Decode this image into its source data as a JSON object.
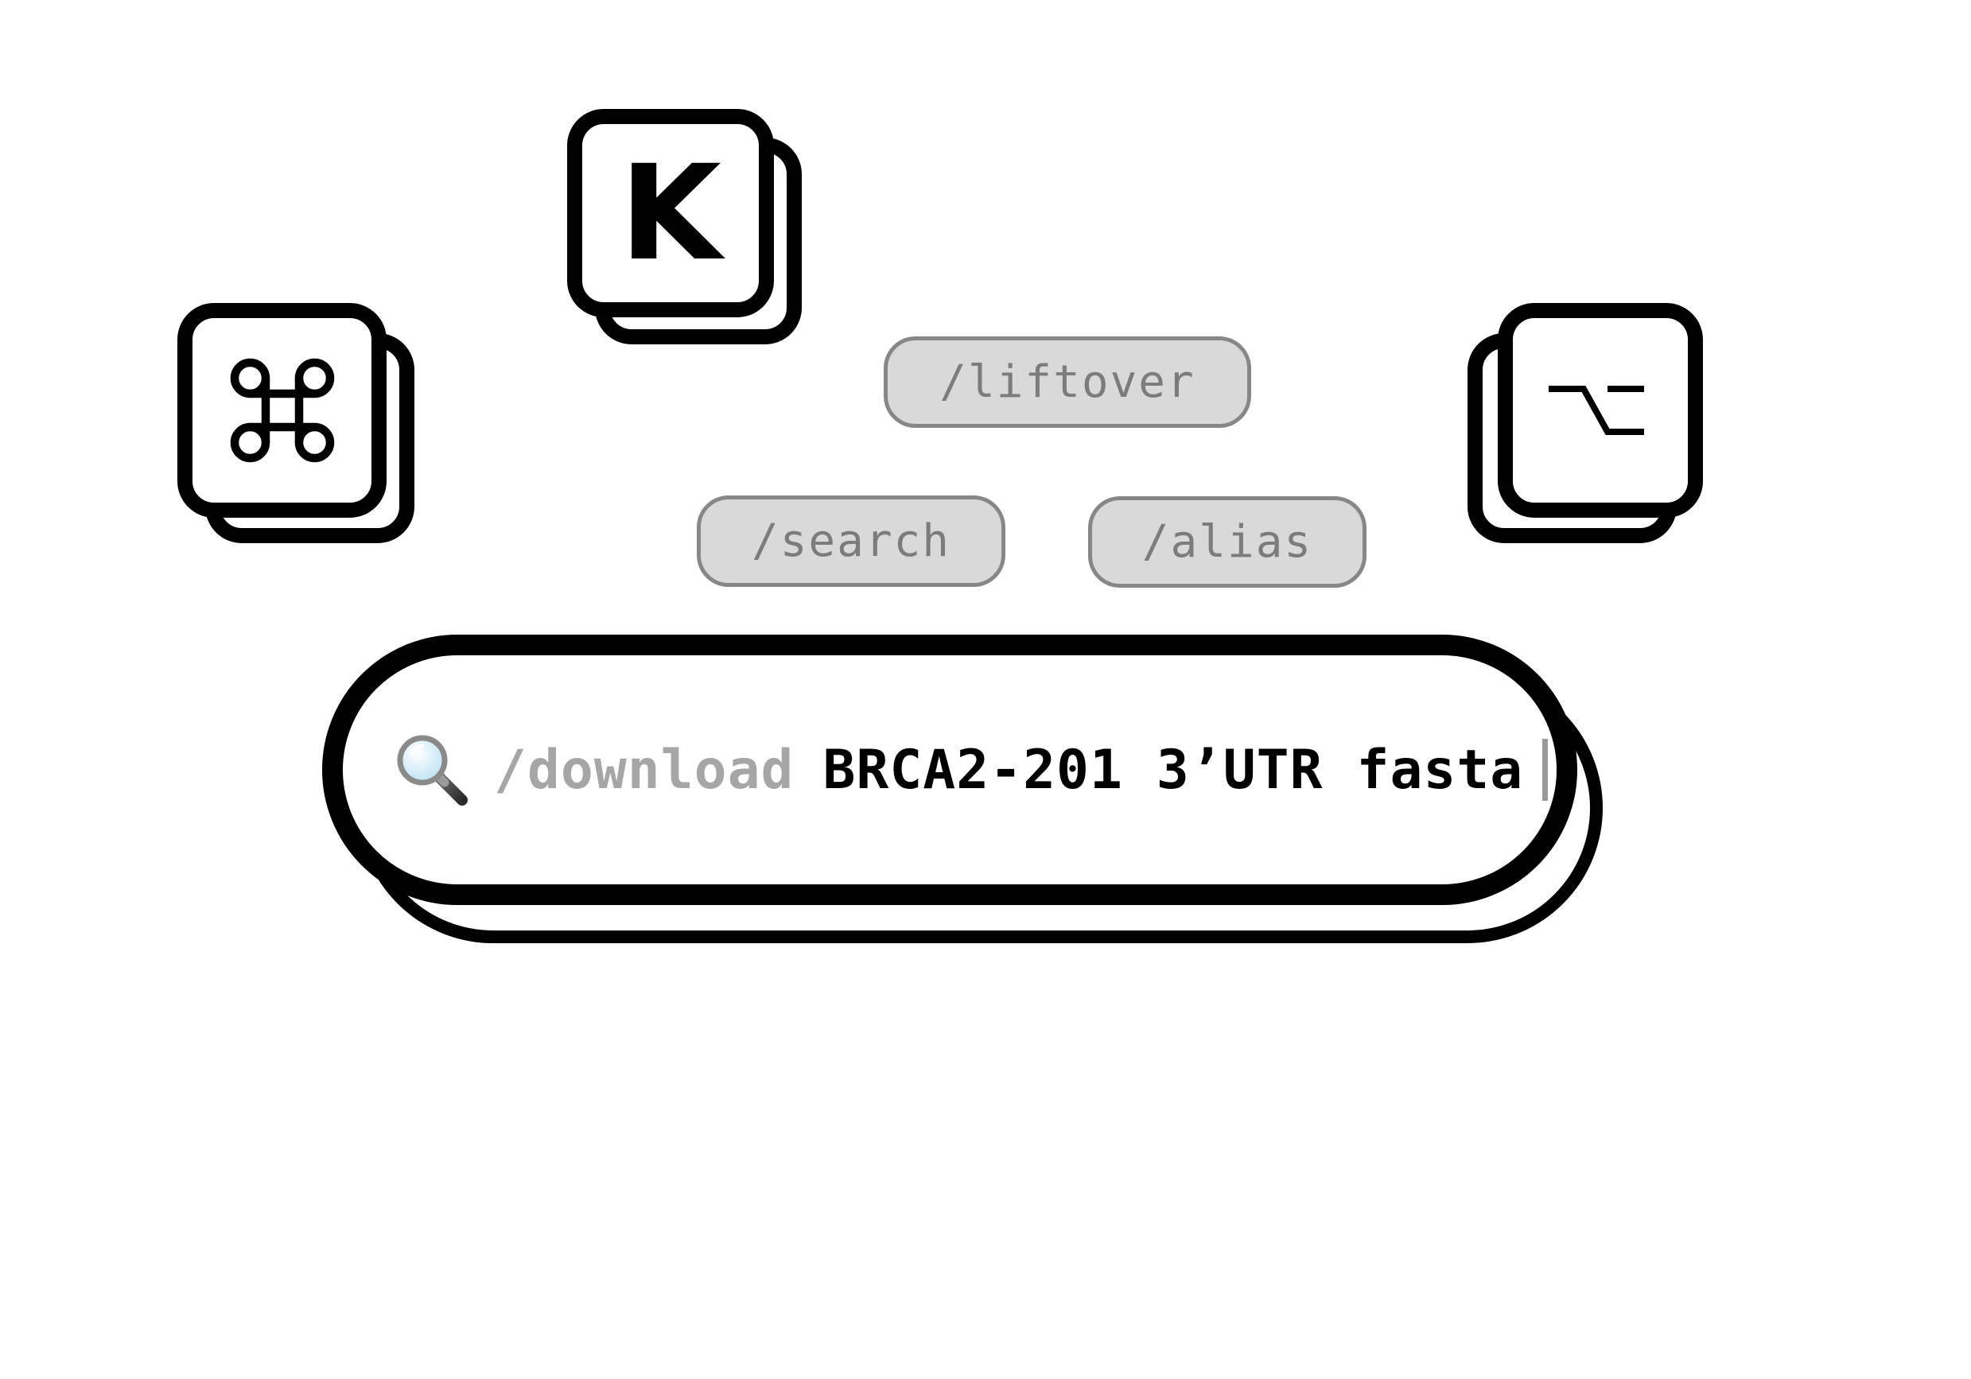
{
  "keys": {
    "k": {
      "label": "K"
    },
    "cmd": {
      "icon": "command-key-icon"
    },
    "opt": {
      "icon": "option-key-icon"
    }
  },
  "chips": {
    "liftover": "/liftover",
    "search": "/search",
    "alias": "/alias"
  },
  "search_bar": {
    "icon": "magnifier-icon",
    "command": "/download",
    "query": "BRCA2-201 3’UTR fasta"
  },
  "colors": {
    "outline": "#000000",
    "chip_fill": "#d9d9d9",
    "chip_border": "#878787",
    "chip_text": "#7c7c7c",
    "command_text": "#a6a6a6",
    "caret": "#9a9a9a"
  }
}
